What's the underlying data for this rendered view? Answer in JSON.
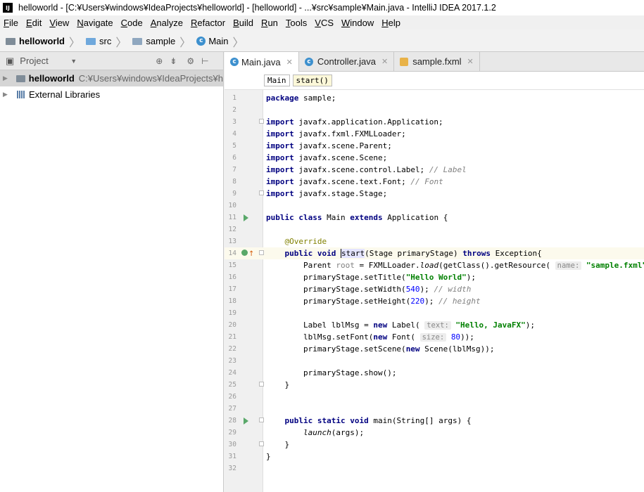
{
  "window": {
    "title": "helloworld - [C:¥Users¥windows¥IdeaProjects¥helloworld] - [helloworld] - ...¥src¥sample¥Main.java - IntelliJ IDEA 2017.1.2",
    "app_icon": "IJ"
  },
  "menu": [
    "File",
    "Edit",
    "View",
    "Navigate",
    "Code",
    "Analyze",
    "Refactor",
    "Build",
    "Run",
    "Tools",
    "VCS",
    "Window",
    "Help"
  ],
  "breadcrumb": {
    "project": "helloworld",
    "src": "src",
    "sample": "sample",
    "main": "Main"
  },
  "project_panel": {
    "title": "Project",
    "tree": {
      "root_name": "helloworld",
      "root_path": "C:¥Users¥windows¥IdeaProjects¥h",
      "libs": "External Libraries"
    }
  },
  "tabs": [
    "Main.java",
    "Controller.java",
    "sample.fxml"
  ],
  "editor_breadcrumb": {
    "class": "Main",
    "method": "start()"
  },
  "code": {
    "l1_pkg": "sample;",
    "imports": [
      "javafx.application.Application;",
      "javafx.fxml.FXMLLoader;",
      "javafx.scene.Parent;",
      "javafx.scene.Scene;",
      "javafx.scene.control.Label;",
      "javafx.scene.text.Font;",
      "javafx.stage.Stage;"
    ],
    "import_comments": {
      "label": "// Label",
      "font": "// Font"
    },
    "class_name": "Main",
    "super_class": "Application {",
    "annotation": "@Override",
    "start_sig": "(Stage primaryStage)",
    "start_name": "start",
    "exception": "Exception{",
    "l15_a": "Parent",
    "l15_b": "root",
    "l15_c": " = FXMLLoader.",
    "l15_d": "load",
    "l15_e": "(getClass().getResource(",
    "hint_name": "name:",
    "fxml_string": "\"sample.fxml\"",
    "l15_end": "));",
    "l16_a": "primaryStage.setTitle(",
    "title_string": "\"Hello World\"",
    "close_paren": ");",
    "l17_a": "primaryStage.setWidth(",
    "width_value": "540",
    "width_comment": "// width",
    "l18_a": "primaryStage.setHeight(",
    "height_value": "220",
    "height_comment": "// height",
    "l20_a": "Label lblMsg = ",
    "l20_b": " Label(",
    "hint_text": "text:",
    "hello_string": "\"Hello, JavaFX\"",
    "l21_a": "lblMsg.setFont(",
    "l21_b": " Font(",
    "hint_size": "size:",
    "size_value": "80",
    "l21_end": "));",
    "l22_a": "primaryStage.setScene(",
    "l22_b": " Scene(lblMsg));",
    "l24": "primaryStage.show();",
    "close_brace": "}",
    "main_sig": "main(String[] args) {",
    "launch": "launch",
    "launch_args": "(args);"
  },
  "keywords": {
    "package": "package",
    "import": "import",
    "public": "public",
    "class": "class",
    "extends": "extends",
    "void": "void",
    "throws": "throws",
    "new": "new",
    "static": "static"
  },
  "line_numbers": [
    "1",
    "2",
    "3",
    "4",
    "5",
    "6",
    "7",
    "8",
    "9",
    "10",
    "11",
    "12",
    "13",
    "14",
    "15",
    "16",
    "17",
    "18",
    "19",
    "20",
    "21",
    "22",
    "23",
    "24",
    "25",
    "26",
    "27",
    "28",
    "29",
    "30",
    "31",
    "32"
  ]
}
